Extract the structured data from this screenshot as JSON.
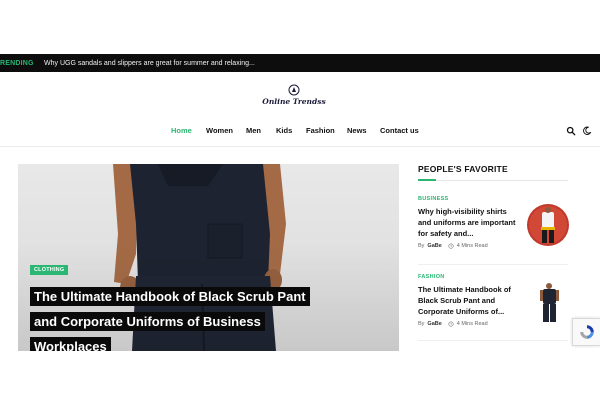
{
  "trending": {
    "label": "RENDING",
    "headline": "Why UGG sandals and slippers are great for summer and relaxing..."
  },
  "logo": {
    "text": "Online Trendss"
  },
  "nav": {
    "items": [
      {
        "label": "Home",
        "active": true
      },
      {
        "label": "Women",
        "active": false
      },
      {
        "label": "Men",
        "active": false
      },
      {
        "label": "Kids",
        "active": false
      },
      {
        "label": "Fashion",
        "active": false
      },
      {
        "label": "News",
        "active": false
      },
      {
        "label": "Contact us",
        "active": false
      }
    ],
    "search_icon": "search-icon",
    "theme_icon": "moon-icon"
  },
  "hero": {
    "category": "CLOTHING",
    "title_lines": [
      "The Ultimate Handbook of Black Scrub Pant",
      "and Corporate Uniforms of Business",
      "Workplaces"
    ]
  },
  "sidebar": {
    "title": "PEOPLE'S FAVORITE",
    "cards": [
      {
        "category": "BUSINESS",
        "title": "Why high-visibility shirts and uniforms are important for safety and...",
        "by": "By",
        "author": "GaBe",
        "read_time": "4 Mins Read"
      },
      {
        "category": "FASHION",
        "title": "The Ultimate Handbook of Black Scrub Pant and Corporate Uniforms of...",
        "by": "By",
        "author": "GaBe",
        "read_time": "4 Mins Read"
      }
    ]
  },
  "colors": {
    "accent": "#2bb673",
    "topbar": "#0d0d0d",
    "title_bg": "#0a0a0a"
  }
}
